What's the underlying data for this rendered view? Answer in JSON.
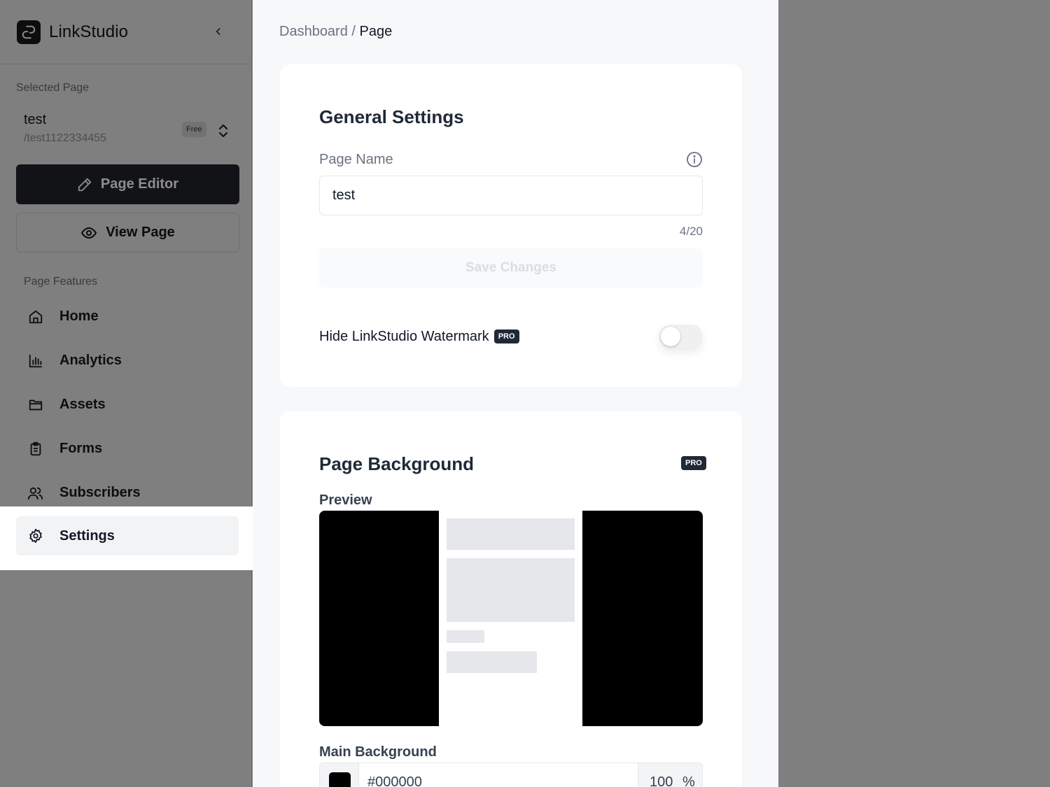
{
  "brand": {
    "name": "LinkStudio"
  },
  "sidebar": {
    "selected_page_label": "Selected Page",
    "page": {
      "name": "test",
      "slug": "/test1122334455",
      "plan": "Free"
    },
    "editor_button": "Page Editor",
    "view_button": "View Page",
    "features_label": "Page Features",
    "items": [
      {
        "label": "Home",
        "icon": "home-icon"
      },
      {
        "label": "Analytics",
        "icon": "bar-chart-icon"
      },
      {
        "label": "Assets",
        "icon": "folder-icon"
      },
      {
        "label": "Forms",
        "icon": "clipboard-icon"
      },
      {
        "label": "Subscribers",
        "icon": "users-icon"
      },
      {
        "label": "Settings",
        "icon": "gear-icon",
        "active": true
      }
    ]
  },
  "breadcrumb": {
    "parent": "Dashboard",
    "separator": "/",
    "current": "Page"
  },
  "general": {
    "title": "General Settings",
    "page_name_label": "Page Name",
    "page_name_value": "test",
    "counter": "4/20",
    "save_button": "Save Changes",
    "watermark_label": "Hide LinkStudio Watermark",
    "watermark_badge": "PRO",
    "watermark_enabled": false
  },
  "background": {
    "title": "Page Background",
    "badge": "PRO",
    "preview_label": "Preview",
    "main_bg_label": "Main Background",
    "main_bg_hex": "#000000",
    "main_bg_opacity": "100",
    "opacity_unit": "%"
  },
  "colors": {
    "accent": "#121317",
    "pro_badge": "#1f2937",
    "preview_bg": "#000000"
  }
}
